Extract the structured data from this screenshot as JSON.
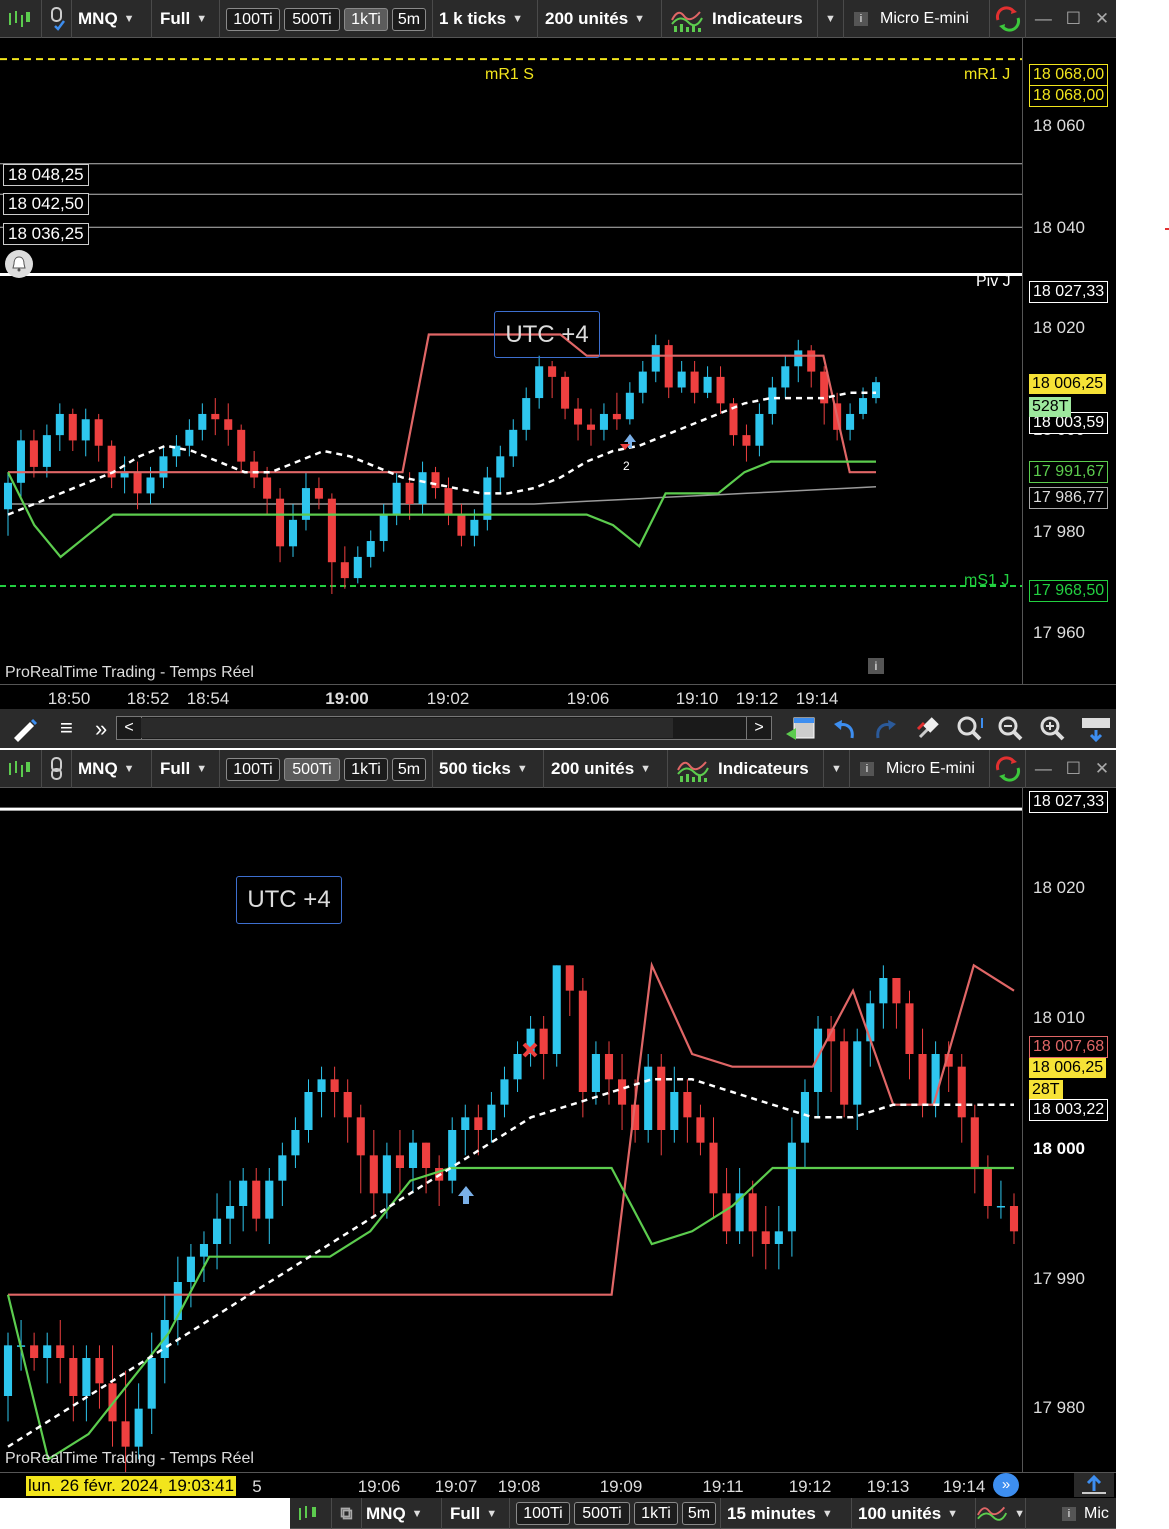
{
  "colors": {
    "up": "#2ec6ee",
    "down": "#ee4040",
    "resistance": "#e06666",
    "support": "#5ccc4e",
    "ma": "#ffffff",
    "pivot_r": "#f2e51c",
    "pivot_s": "#22d040",
    "grey_line": "#9a9a9a",
    "toolbar_bg": "#2a2a2a",
    "date_bg": "#f2e51c"
  },
  "top": {
    "toolbar": {
      "symbol": "MNQ",
      "mode": "Full",
      "buttons": [
        "100Ti",
        "500Ti",
        "1kTi",
        "5m"
      ],
      "active_button": "1kTi",
      "interval": "1 k ticks",
      "units": "200 unités",
      "indicators": "Indicateurs",
      "instrument": "Micro E-mini"
    },
    "utc_label": "UTC +4",
    "footer": "ProRealTime Trading - Temps Réel",
    "levels": {
      "mr1s": "mR1 S",
      "mr1j": "mR1 J",
      "pivj": "Piv J",
      "ms1j": "mS1 J"
    },
    "price_tags": [
      "18 048,25",
      "18 042,50",
      "18 036,25"
    ],
    "axis_labels": [
      "18 060",
      "18 040",
      "18 020",
      "18 000",
      "17 980",
      "17 960"
    ],
    "axis_badges": {
      "mr1_a": "18 068,00",
      "mr1_b": "18 068,00",
      "piv": "18 027,33",
      "last": "18 006,25",
      "ticks": "528T",
      "ma": "18 003,59",
      "support": "17 991,67",
      "grey": "17 986,77",
      "ms1": "17 968,50"
    },
    "time_labels": [
      "18:50",
      "18:52",
      "18:54",
      "19:00",
      "19:02",
      "19:06",
      "19:10",
      "19:12",
      "19:14"
    ],
    "arrow_label": "2"
  },
  "nav": {
    "scroll_left": "<",
    "scroll_right": ">",
    "more": "»"
  },
  "bottom": {
    "toolbar": {
      "symbol": "MNQ",
      "mode": "Full",
      "buttons": [
        "100Ti",
        "500Ti",
        "1kTi",
        "5m"
      ],
      "active_button": "500Ti",
      "interval": "500 ticks",
      "units": "200 unités",
      "indicators": "Indicateurs",
      "instrument": "Micro E-mini"
    },
    "utc_label": "UTC +4",
    "footer": "ProRealTime Trading - Temps Réel",
    "axis_labels": [
      "18 020",
      "18 010",
      "17 990",
      "17 980"
    ],
    "axis_bold": "18 000",
    "axis_badges": {
      "piv": "18 027,33",
      "resistance": "18 007,68",
      "last": "18 006,25",
      "ticks": "28T",
      "ma": "18 003,22"
    },
    "date_label": "lun. 26 févr. 2024, 19:03:41",
    "date_suffix": "5",
    "time_labels": [
      "19:06",
      "19:07",
      "19:08",
      "19:09",
      "19:11",
      "19:12",
      "19:13",
      "19:14"
    ]
  },
  "third": {
    "toolbar": {
      "symbol": "MNQ",
      "mode": "Full",
      "buttons": [
        "100Ti",
        "500Ti",
        "1kTi",
        "5m"
      ],
      "interval": "15 minutes",
      "units": "100 unités",
      "instrument": "Mic"
    }
  },
  "chart_data": [
    {
      "type": "candlestick",
      "title": "MNQ 1 k ticks",
      "ylim": [
        17950,
        18072
      ],
      "x_ticks": [
        "18:50",
        "18:52",
        "18:54",
        "19:00",
        "19:02",
        "19:06",
        "19:10",
        "19:12",
        "19:14"
      ],
      "candles": [
        [
          17983,
          17988,
          17978,
          17990
        ],
        [
          17988,
          17996,
          17985,
          17998
        ],
        [
          17996,
          17991,
          17989,
          17998
        ],
        [
          17991,
          17997,
          17989,
          17999
        ],
        [
          17997,
          18001,
          17994,
          18003
        ],
        [
          18001,
          17996,
          17994,
          18002
        ],
        [
          17996,
          18000,
          17993,
          18002
        ],
        [
          18000,
          17995,
          17992,
          18001
        ],
        [
          17995,
          17989,
          17987,
          17996
        ],
        [
          17989,
          17990,
          17986,
          17993
        ],
        [
          17990,
          17986,
          17983,
          17992
        ],
        [
          17986,
          17989,
          17984,
          17991
        ],
        [
          17989,
          17993,
          17987,
          17995
        ],
        [
          17993,
          17995,
          17991,
          17997
        ],
        [
          17995,
          17998,
          17993,
          18000
        ],
        [
          17998,
          18001,
          17996,
          18003
        ],
        [
          18001,
          18000,
          17997,
          18004
        ],
        [
          18000,
          17998,
          17995,
          18003
        ],
        [
          17998,
          17992,
          17990,
          17999
        ],
        [
          17992,
          17989,
          17987,
          17994
        ],
        [
          17989,
          17985,
          17982,
          17991
        ],
        [
          17985,
          17976,
          17973,
          17987
        ],
        [
          17976,
          17981,
          17974,
          17984
        ],
        [
          17981,
          17987,
          17979,
          17990
        ],
        [
          17987,
          17985,
          17983,
          17989
        ],
        [
          17985,
          17973,
          17967,
          17986
        ],
        [
          17973,
          17970,
          17968,
          17976
        ],
        [
          17970,
          17974,
          17969,
          17976
        ],
        [
          17974,
          17977,
          17972,
          17979
        ],
        [
          17977,
          17982,
          17975,
          17984
        ],
        [
          17982,
          17988,
          17980,
          17990
        ],
        [
          17988,
          17984,
          17981,
          17990
        ],
        [
          17984,
          17990,
          17982,
          17992
        ],
        [
          17990,
          17987,
          17985,
          17991
        ],
        [
          17987,
          17982,
          17980,
          17989
        ],
        [
          17982,
          17978,
          17976,
          17984
        ],
        [
          17978,
          17981,
          17976,
          17983
        ],
        [
          17981,
          17989,
          17979,
          17991
        ],
        [
          17989,
          17993,
          17986,
          17995
        ],
        [
          17993,
          17998,
          17991,
          18000
        ],
        [
          17998,
          18004,
          17996,
          18006
        ],
        [
          18004,
          18010,
          18002,
          18012
        ],
        [
          18010,
          18008,
          18004,
          18011
        ],
        [
          18008,
          18002,
          18000,
          18009
        ],
        [
          18002,
          17999,
          17996,
          18004
        ],
        [
          17999,
          17998,
          17995,
          18002
        ],
        [
          17998,
          18001,
          17996,
          18003
        ],
        [
          18001,
          18000,
          17998,
          18005
        ],
        [
          18000,
          18005,
          17999,
          18007
        ],
        [
          18005,
          18009,
          18003,
          18011
        ],
        [
          18009,
          18014,
          18007,
          18016
        ],
        [
          18014,
          18006,
          18004,
          18015
        ],
        [
          18006,
          18009,
          18005,
          18011
        ],
        [
          18009,
          18005,
          18003,
          18011
        ],
        [
          18005,
          18008,
          18004,
          18010
        ],
        [
          18008,
          18003,
          18001,
          18010
        ],
        [
          18003,
          17997,
          17995,
          18004
        ],
        [
          17997,
          17995,
          17992,
          17999
        ],
        [
          17995,
          18001,
          17993,
          18003
        ],
        [
          18001,
          18006,
          17999,
          18008
        ],
        [
          18006,
          18010,
          18004,
          18012
        ],
        [
          18010,
          18013,
          18007,
          18015
        ],
        [
          18013,
          18009,
          18006,
          18014
        ],
        [
          18009,
          18003,
          17999,
          18010
        ],
        [
          18003,
          17998,
          17996,
          18005
        ],
        [
          17998,
          18001,
          17996,
          18003
        ],
        [
          18001,
          18004,
          18000,
          18006
        ],
        [
          18004,
          18007,
          18003,
          18008
        ]
      ],
      "ma": [
        17982,
        17984,
        17986,
        17988,
        17990,
        17993,
        17995,
        17994,
        17992,
        17990,
        17990,
        17992,
        17994,
        17993,
        17991,
        17989,
        17988,
        17987,
        17986,
        17986,
        17987,
        17989,
        17992,
        17994,
        17995,
        17997,
        17999,
        18001,
        18003,
        18004,
        18004,
        18004,
        18005,
        18005
      ],
      "resistance": [
        17990,
        17990,
        17990,
        17990,
        17990,
        17990,
        17990,
        17990,
        17990,
        17990,
        17990,
        17990,
        17990,
        17990,
        17990,
        17990,
        18016,
        18016,
        18016,
        18016,
        18016,
        18016,
        18012,
        18012,
        18012,
        18012,
        18012,
        18012,
        18012,
        18012,
        18012,
        18012,
        17990,
        17990
      ],
      "support": [
        17990,
        17980,
        17974,
        17978,
        17982,
        17982,
        17982,
        17982,
        17982,
        17982,
        17982,
        17982,
        17982,
        17982,
        17982,
        17982,
        17982,
        17982,
        17982,
        17982,
        17982,
        17982,
        17982,
        17980,
        17976,
        17986,
        17986,
        17986,
        17990,
        17992,
        17992,
        17992,
        17992,
        17992
      ],
      "levels": {
        "mR1 S": 18068.0,
        "mR1 J": 18068.0,
        "Piv J": 18027.33,
        "mS1 J": 17968.5
      }
    },
    {
      "type": "candlestick",
      "title": "MNQ 500 ticks",
      "ylim": [
        17975,
        18029
      ],
      "x_ticks": [
        "19:06",
        "19:07",
        "19:08",
        "19:09",
        "19:11",
        "19:12",
        "19:13",
        "19:14"
      ],
      "candles": [
        [
          17981,
          17985,
          17979,
          17986
        ],
        [
          17985,
          17985,
          17983,
          17987
        ],
        [
          17985,
          17984,
          17983,
          17986
        ],
        [
          17984,
          17985,
          17982,
          17986
        ],
        [
          17985,
          17984,
          17982,
          17987
        ],
        [
          17984,
          17981,
          17979,
          17985
        ],
        [
          17981,
          17984,
          17979,
          17985
        ],
        [
          17984,
          17982,
          17980,
          17985
        ],
        [
          17982,
          17979,
          17977,
          17985
        ],
        [
          17979,
          17977,
          17975,
          17983
        ],
        [
          17977,
          17980,
          17976,
          17982
        ],
        [
          17980,
          17984,
          17978,
          17986
        ],
        [
          17984,
          17987,
          17982,
          17989
        ],
        [
          17987,
          17990,
          17985,
          17992
        ],
        [
          17990,
          17992,
          17988,
          17993
        ],
        [
          17992,
          17993,
          17990,
          17994
        ],
        [
          17993,
          17995,
          17991,
          17997
        ],
        [
          17995,
          17996,
          17993,
          17998
        ],
        [
          17996,
          17998,
          17994,
          17999
        ],
        [
          17998,
          17995,
          17994,
          17999
        ],
        [
          17995,
          17998,
          17993,
          17999
        ],
        [
          17998,
          18000,
          17996,
          18001
        ],
        [
          18000,
          18002,
          17999,
          18003
        ],
        [
          18002,
          18005,
          18001,
          18006
        ],
        [
          18005,
          18006,
          18003,
          18007
        ],
        [
          18006,
          18005,
          18003,
          18007
        ],
        [
          18005,
          18003,
          18001,
          18006
        ],
        [
          18003,
          18000,
          17997,
          18004
        ],
        [
          18000,
          17997,
          17995,
          18002
        ],
        [
          17997,
          18000,
          17995,
          18001
        ],
        [
          18000,
          17999,
          17997,
          18002
        ],
        [
          17999,
          18001,
          17997,
          18002
        ],
        [
          18001,
          17999,
          17997,
          18001
        ],
        [
          17999,
          17998,
          17996,
          18000
        ],
        [
          17998,
          18002,
          17997,
          18003
        ],
        [
          18002,
          18003,
          18000,
          18004
        ],
        [
          18003,
          18002,
          18000,
          18004
        ],
        [
          18002,
          18004,
          18001,
          18005
        ],
        [
          18004,
          18006,
          18003,
          18007
        ],
        [
          18006,
          18008,
          18005,
          18009
        ],
        [
          18008,
          18010,
          18007,
          18011
        ],
        [
          18010,
          18008,
          18006,
          18011
        ],
        [
          18008,
          18015,
          18007,
          18015
        ],
        [
          18015,
          18013,
          18011,
          18015
        ],
        [
          18013,
          18005,
          18003,
          18014
        ],
        [
          18005,
          18008,
          18004,
          18009
        ],
        [
          18008,
          18006,
          18004,
          18009
        ],
        [
          18006,
          18004,
          18002,
          18008
        ],
        [
          18004,
          18002,
          18001,
          18006
        ],
        [
          18002,
          18007,
          18001,
          18008
        ],
        [
          18007,
          18002,
          18000,
          18008
        ],
        [
          18002,
          18005,
          18001,
          18007
        ],
        [
          18005,
          18003,
          18001,
          18006
        ],
        [
          18003,
          18001,
          18000,
          18004
        ],
        [
          18001,
          17997,
          17995,
          18003
        ],
        [
          17997,
          17994,
          17993,
          17999
        ],
        [
          17994,
          17997,
          17993,
          17999
        ],
        [
          17997,
          17994,
          17992,
          17998
        ],
        [
          17994,
          17993,
          17991,
          17996
        ],
        [
          17993,
          17994,
          17991,
          17996
        ],
        [
          17994,
          18001,
          17992,
          18003
        ],
        [
          18001,
          18005,
          17999,
          18006
        ],
        [
          18005,
          18010,
          18003,
          18011
        ],
        [
          18010,
          18009,
          18005,
          18011
        ],
        [
          18009,
          18004,
          18003,
          18010
        ],
        [
          18004,
          18009,
          18002,
          18010
        ],
        [
          18009,
          18012,
          18007,
          18013
        ],
        [
          18012,
          18014,
          18010,
          18015
        ],
        [
          18014,
          18012,
          18010,
          18014
        ],
        [
          18012,
          18008,
          18006,
          18013
        ],
        [
          18008,
          18004,
          18003,
          18010
        ],
        [
          18004,
          18008,
          18003,
          18009
        ],
        [
          18008,
          18007,
          18005,
          18009
        ],
        [
          18007,
          18003,
          18001,
          18008
        ],
        [
          18003,
          17999,
          17997,
          18004
        ],
        [
          17999,
          17996,
          17995,
          18000
        ],
        [
          17996,
          17996,
          17995,
          17998
        ],
        [
          17996,
          17994,
          17993,
          17997
        ]
      ],
      "ma": [
        17977,
        17979,
        17981,
        17983,
        17985,
        17987,
        17989,
        17991,
        17993,
        17995,
        17997,
        17999,
        18001,
        18003,
        18004,
        18005,
        18006,
        18006,
        18005,
        18004,
        18003,
        18003,
        18004,
        18004,
        18004,
        18004
      ],
      "resistance": [
        17989,
        17989,
        17989,
        17989,
        17989,
        17989,
        17989,
        17989,
        17989,
        17989,
        17989,
        17989,
        17989,
        17989,
        17989,
        17989,
        18015,
        18008,
        18007,
        18007,
        18007,
        18013,
        18004,
        18004,
        18015,
        18013
      ],
      "support": [
        17989,
        17976,
        17978,
        17982,
        17986,
        17992,
        17992,
        17992,
        17992,
        17994,
        17998,
        17999,
        17999,
        17999,
        17999,
        17999,
        17993,
        17994,
        17996,
        17999,
        17999,
        17999,
        17999,
        17999,
        17999,
        17999
      ]
    }
  ]
}
